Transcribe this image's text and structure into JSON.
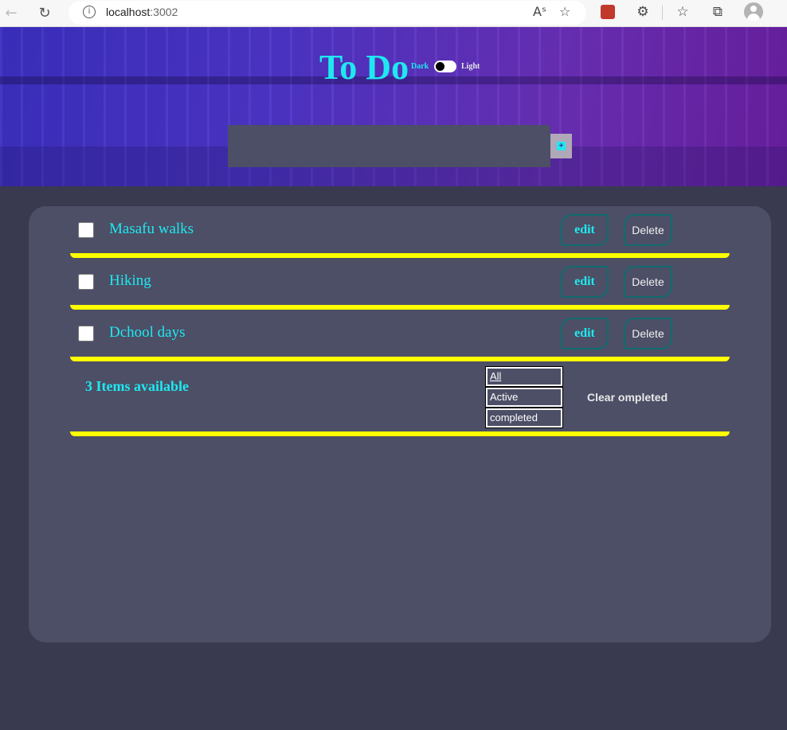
{
  "browser": {
    "url_host": "localhost",
    "url_port": ":3002"
  },
  "header": {
    "title": "To Do",
    "mode_dark": "Dark",
    "mode_light": "Light",
    "new_todo_value": ""
  },
  "todos": [
    {
      "text": "Masafu walks",
      "edit_label": "edit",
      "delete_label": "Delete"
    },
    {
      "text": "Hiking",
      "edit_label": "edit",
      "delete_label": "Delete"
    },
    {
      "text": "Dchool days",
      "edit_label": "edit",
      "delete_label": "Delete"
    }
  ],
  "footer": {
    "items_left": "3 Items available",
    "filters": [
      "All",
      "Active",
      "completed"
    ],
    "clear_label": "Clear ompleted"
  },
  "colors": {
    "accent": "#1fe8f0",
    "underline": "#ffff00",
    "card": "#4c4f66",
    "page": "#393a4f"
  }
}
